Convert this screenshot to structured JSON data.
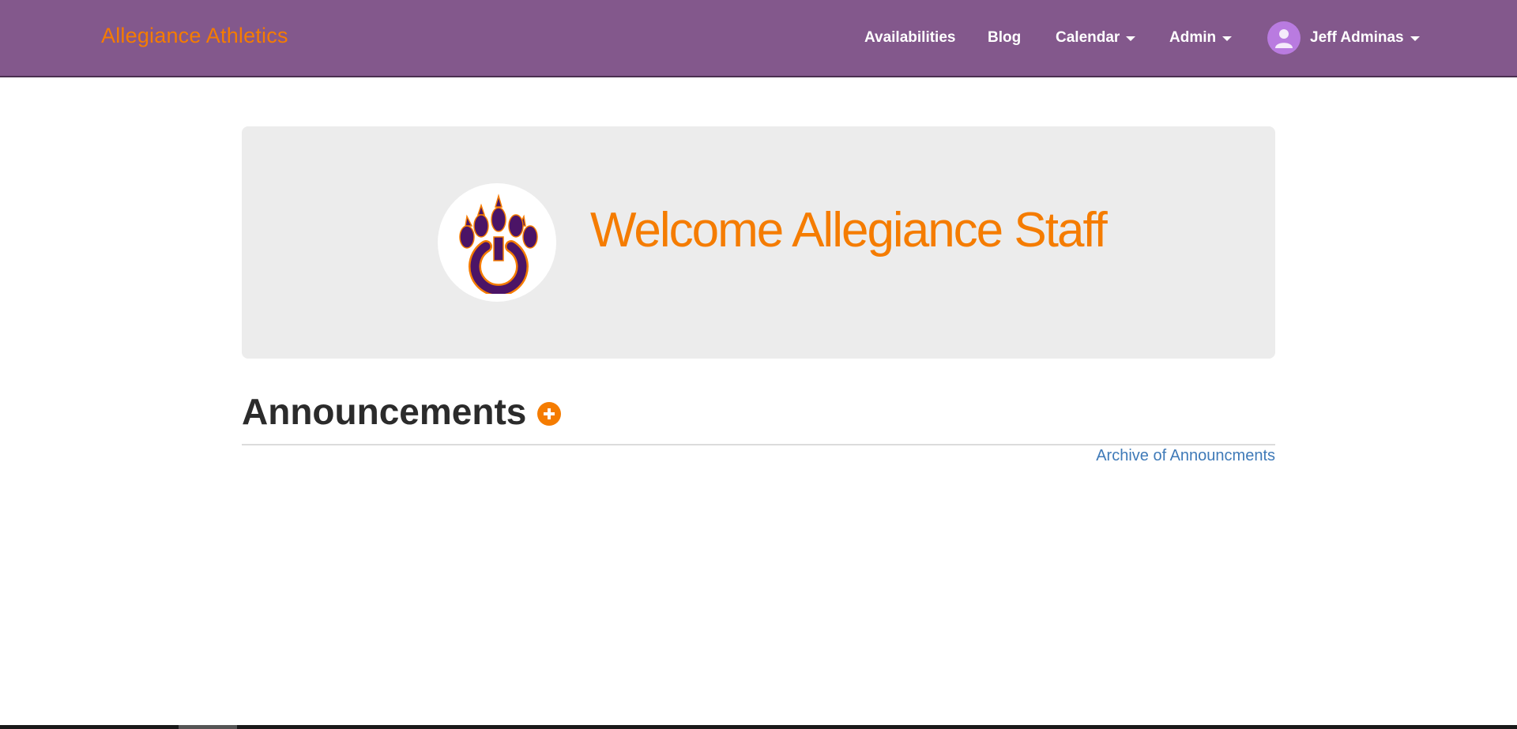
{
  "navbar": {
    "brand": "Allegiance Athletics",
    "items": [
      {
        "label": "Availabilities",
        "dropdown": false
      },
      {
        "label": "Blog",
        "dropdown": false
      },
      {
        "label": "Calendar",
        "dropdown": true
      },
      {
        "label": "Admin",
        "dropdown": true
      }
    ],
    "user": {
      "name": "Jeff Adminas",
      "dropdown": true,
      "icon": "user-avatar-icon"
    }
  },
  "jumbotron": {
    "logo_icon": "paw-power-logo",
    "welcome_text": "Welcome Allegiance Staff"
  },
  "announcements": {
    "title": "Announcements",
    "add_icon": "plus-circle-icon",
    "archive_link": "Archive of Announcments"
  },
  "colors": {
    "navbar_bg": "#83588c",
    "accent_orange": "#f57c00",
    "link_blue": "#3f7ab8",
    "jumbotron_bg": "#ececec",
    "logo_purple": "#4b1466"
  }
}
